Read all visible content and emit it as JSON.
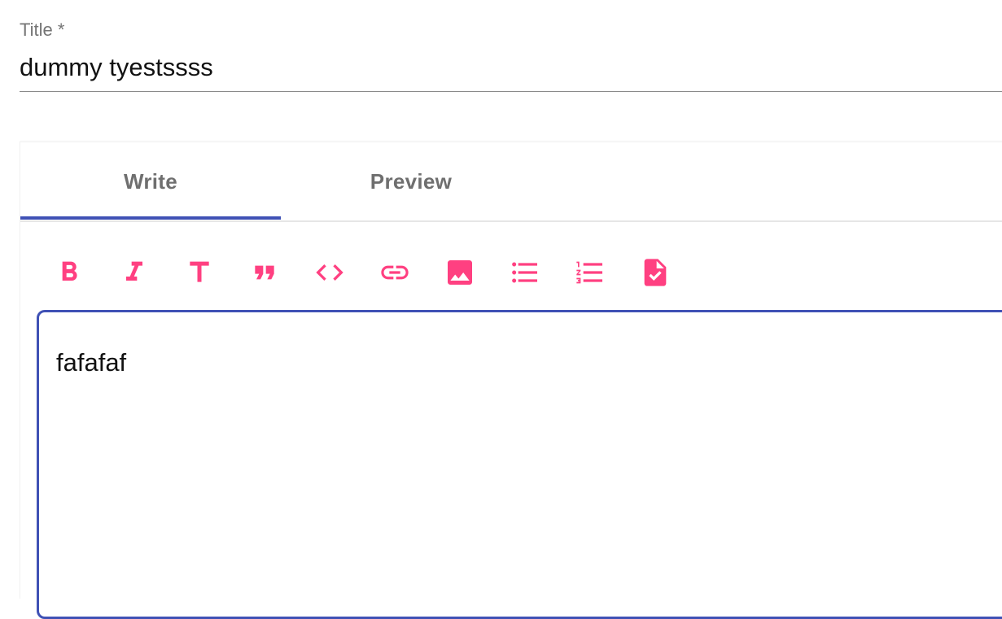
{
  "title_field": {
    "label": "Title *",
    "value": "dummy tyestssss"
  },
  "tabs": [
    {
      "label": "Write",
      "active": true
    },
    {
      "label": "Preview",
      "active": false
    }
  ],
  "toolbar": {
    "icons": [
      "bold-icon",
      "italic-icon",
      "header-icon",
      "quote-icon",
      "code-icon",
      "link-icon",
      "image-icon",
      "unordered-list-icon",
      "ordered-list-icon",
      "checked-list-icon"
    ],
    "icon_color": "#ff4081"
  },
  "editor": {
    "content": "fafafaf"
  },
  "colors": {
    "accent": "#3f51b5",
    "icon": "#ff4081"
  }
}
